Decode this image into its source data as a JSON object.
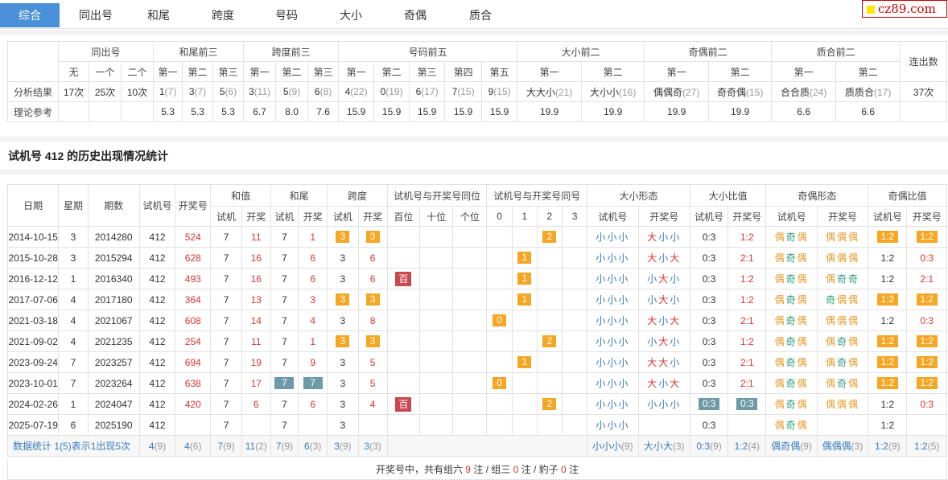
{
  "tabs": [
    "综合",
    "同出号",
    "和尾",
    "跨度",
    "号码",
    "大小",
    "奇偶",
    "质合"
  ],
  "logo": "cz89.com",
  "summary": {
    "groups": [
      "同出号",
      "和尾前三",
      "跨度前三",
      "号码前五",
      "大小前二",
      "奇偶前二",
      "质合前二",
      "连出数"
    ],
    "sub": [
      "无",
      "一个",
      "二个",
      "第一",
      "第二",
      "第三",
      "第一",
      "第二",
      "第三",
      "第一",
      "第二",
      "第三",
      "第四",
      "第五",
      "第一",
      "第二",
      "第一",
      "第二",
      "第一",
      "第二"
    ],
    "row1_label": "分析结果",
    "row1": [
      [
        "17次",
        ""
      ],
      [
        "25次",
        ""
      ],
      [
        "10次",
        ""
      ],
      [
        "1",
        "(7)"
      ],
      [
        "3",
        "(7)"
      ],
      [
        "5",
        "(6)"
      ],
      [
        "3",
        "(11)"
      ],
      [
        "5",
        "(9)"
      ],
      [
        "6",
        "(8)"
      ],
      [
        "4",
        "(22)"
      ],
      [
        "0",
        "(19)"
      ],
      [
        "6",
        "(17)"
      ],
      [
        "7",
        "(15)"
      ],
      [
        "9",
        "(15)"
      ],
      [
        "大大小",
        "(21)"
      ],
      [
        "大小小",
        "(16)"
      ],
      [
        "偶偶奇",
        "(27)"
      ],
      [
        "奇奇偶",
        "(15)"
      ],
      [
        "合合质",
        "(24)"
      ],
      [
        "质质合",
        "(17)"
      ],
      [
        "37次",
        ""
      ]
    ],
    "row2_label": "理论参考",
    "row2": [
      "",
      "",
      "",
      "5.3",
      "5.3",
      "5.3",
      "6.7",
      "8.0",
      "7.6",
      "15.9",
      "15.9",
      "15.9",
      "15.9",
      "15.9",
      "19.9",
      "19.9",
      "19.9",
      "19.9",
      "6.6",
      "6.6",
      ""
    ]
  },
  "section_title": "试机号 412 的历史出现情况统计",
  "hist": {
    "h1": [
      "日期",
      "星期",
      "期数",
      "试机号",
      "开奖号",
      "和值",
      "和尾",
      "跨度",
      "试机号与开奖号同位",
      "试机号与开奖号同号",
      "大小形态",
      "大小比值",
      "奇偶形态",
      "奇偶比值"
    ],
    "h2": [
      "试机",
      "开奖",
      "试机",
      "开奖",
      "试机",
      "开奖",
      "百位",
      "十位",
      "个位",
      "0",
      "1",
      "2",
      "3",
      "试机号",
      "开奖号",
      "试机号",
      "开奖号",
      "试机号",
      "开奖号",
      "试机号",
      "开奖号"
    ],
    "rows": [
      {
        "date": "2014-10-15",
        "wk": "3",
        "issue": "2014280",
        "sj": "412",
        "kj": "524",
        "hz_s": "7",
        "hz_k": "11",
        "hw_s": "7",
        "hw_k": "1",
        "kd_s": "3",
        "kd_k": "3",
        "kd_hl": "o",
        "pos": "",
        "pos_i": -1,
        "same": "2",
        "same_i": 2,
        "dx_s": "小小小",
        "dx_k": [
          "大",
          "小",
          "小"
        ],
        "dxb_s": "0:3",
        "dxb_k": "1:2",
        "dxb_hl": "",
        "jo_s": "偶奇偶",
        "jo_k": [
          "偶",
          "偶",
          "偶"
        ],
        "job_s": "1:2",
        "job_k": "1:2",
        "job_hl": "o",
        "hw_hl": ""
      },
      {
        "date": "2015-10-28",
        "wk": "3",
        "issue": "2015294",
        "sj": "412",
        "kj": "628",
        "hz_s": "7",
        "hz_k": "16",
        "hw_s": "7",
        "hw_k": "6",
        "kd_s": "3",
        "kd_k": "6",
        "kd_hl": "",
        "pos": "",
        "pos_i": -1,
        "same": "1",
        "same_i": 1,
        "dx_s": "小小小",
        "dx_k": [
          "大",
          "小",
          "大"
        ],
        "dxb_s": "0:3",
        "dxb_k": "2:1",
        "dxb_hl": "",
        "jo_s": "偶奇偶",
        "jo_k": [
          "偶",
          "偶",
          "偶"
        ],
        "job_s": "1:2",
        "job_k": "0:3",
        "job_hl": "",
        "hw_hl": ""
      },
      {
        "date": "2016-12-12",
        "wk": "1",
        "issue": "2016340",
        "sj": "412",
        "kj": "493",
        "hz_s": "7",
        "hz_k": "16",
        "hw_s": "7",
        "hw_k": "6",
        "kd_s": "3",
        "kd_k": "6",
        "kd_hl": "",
        "pos": "百",
        "pos_i": 0,
        "same": "1",
        "same_i": 1,
        "dx_s": "小小小",
        "dx_k": [
          "小",
          "大",
          "小"
        ],
        "dxb_s": "0:3",
        "dxb_k": "1:2",
        "dxb_hl": "",
        "jo_s": "偶奇偶",
        "jo_k": [
          "偶",
          "奇",
          "奇"
        ],
        "job_s": "1:2",
        "job_k": "2:1",
        "job_hl": "",
        "hw_hl": ""
      },
      {
        "date": "2017-07-06",
        "wk": "4",
        "issue": "2017180",
        "sj": "412",
        "kj": "364",
        "hz_s": "7",
        "hz_k": "13",
        "hw_s": "7",
        "hw_k": "3",
        "kd_s": "3",
        "kd_k": "3",
        "kd_hl": "o",
        "pos": "",
        "pos_i": -1,
        "same": "1",
        "same_i": 1,
        "dx_s": "小小小",
        "dx_k": [
          "小",
          "大",
          "小"
        ],
        "dxb_s": "0:3",
        "dxb_k": "1:2",
        "dxb_hl": "",
        "jo_s": "偶奇偶",
        "jo_k": [
          "奇",
          "偶",
          "偶"
        ],
        "job_s": "1:2",
        "job_k": "1:2",
        "job_hl": "o",
        "hw_hl": ""
      },
      {
        "date": "2021-03-18",
        "wk": "4",
        "issue": "2021067",
        "sj": "412",
        "kj": "608",
        "hz_s": "7",
        "hz_k": "14",
        "hw_s": "7",
        "hw_k": "4",
        "kd_s": "3",
        "kd_k": "8",
        "kd_hl": "",
        "pos": "",
        "pos_i": -1,
        "same": "0",
        "same_i": 0,
        "dx_s": "小小小",
        "dx_k": [
          "大",
          "小",
          "大"
        ],
        "dxb_s": "0:3",
        "dxb_k": "2:1",
        "dxb_hl": "",
        "jo_s": "偶奇偶",
        "jo_k": [
          "偶",
          "偶",
          "偶"
        ],
        "job_s": "1:2",
        "job_k": "0:3",
        "job_hl": "",
        "hw_hl": ""
      },
      {
        "date": "2021-09-02",
        "wk": "4",
        "issue": "2021235",
        "sj": "412",
        "kj": "254",
        "hz_s": "7",
        "hz_k": "11",
        "hw_s": "7",
        "hw_k": "1",
        "kd_s": "3",
        "kd_k": "3",
        "kd_hl": "o",
        "pos": "",
        "pos_i": -1,
        "same": "2",
        "same_i": 2,
        "dx_s": "小小小",
        "dx_k": [
          "小",
          "大",
          "小"
        ],
        "dxb_s": "0:3",
        "dxb_k": "1:2",
        "dxb_hl": "",
        "jo_s": "偶奇偶",
        "jo_k": [
          "偶",
          "奇",
          "偶"
        ],
        "job_s": "1:2",
        "job_k": "1:2",
        "job_hl": "o",
        "hw_hl": ""
      },
      {
        "date": "2023-09-24",
        "wk": "7",
        "issue": "2023257",
        "sj": "412",
        "kj": "694",
        "hz_s": "7",
        "hz_k": "19",
        "hw_s": "7",
        "hw_k": "9",
        "kd_s": "3",
        "kd_k": "5",
        "kd_hl": "",
        "pos": "",
        "pos_i": -1,
        "same": "1",
        "same_i": 1,
        "dx_s": "小小小",
        "dx_k": [
          "大",
          "大",
          "小"
        ],
        "dxb_s": "0:3",
        "dxb_k": "2:1",
        "dxb_hl": "",
        "jo_s": "偶奇偶",
        "jo_k": [
          "偶",
          "奇",
          "偶"
        ],
        "job_s": "1:2",
        "job_k": "1:2",
        "job_hl": "o",
        "hw_hl": ""
      },
      {
        "date": "2023-10-01",
        "wk": "7",
        "issue": "2023264",
        "sj": "412",
        "kj": "638",
        "hz_s": "7",
        "hz_k": "17",
        "hw_s": "7",
        "hw_k": "7",
        "kd_s": "3",
        "kd_k": "5",
        "kd_hl": "",
        "pos": "",
        "pos_i": -1,
        "same": "0",
        "same_i": 0,
        "dx_s": "小小小",
        "dx_k": [
          "大",
          "小",
          "大"
        ],
        "dxb_s": "0:3",
        "dxb_k": "2:1",
        "dxb_hl": "",
        "jo_s": "偶奇偶",
        "jo_k": [
          "偶",
          "奇",
          "偶"
        ],
        "job_s": "1:2",
        "job_k": "1:2",
        "job_hl": "o",
        "hw_hl": "g"
      },
      {
        "date": "2024-02-26",
        "wk": "1",
        "issue": "2024047",
        "sj": "412",
        "kj": "420",
        "hz_s": "7",
        "hz_k": "6",
        "hw_s": "7",
        "hw_k": "6",
        "kd_s": "3",
        "kd_k": "4",
        "kd_hl": "",
        "pos": "百",
        "pos_i": 0,
        "same": "2",
        "same_i": 2,
        "dx_s": "小小小",
        "dx_k": [
          "小",
          "小",
          "小"
        ],
        "dxb_s": "0:3",
        "dxb_k": "0:3",
        "dxb_hl": "g",
        "jo_s": "偶奇偶",
        "jo_k": [
          "偶",
          "偶",
          "偶"
        ],
        "job_s": "1:2",
        "job_k": "0:3",
        "job_hl": "",
        "hw_hl": ""
      },
      {
        "date": "2025-07-19",
        "wk": "6",
        "issue": "2025190",
        "sj": "412",
        "kj": "",
        "hz_s": "7",
        "hz_k": "",
        "hw_s": "7",
        "hw_k": "",
        "kd_s": "3",
        "kd_k": "",
        "kd_hl": "",
        "pos": "",
        "pos_i": -1,
        "same": "",
        "same_i": -1,
        "dx_s": "小小小",
        "dx_k": [
          "",
          "",
          ""
        ],
        "dxb_s": "0:3",
        "dxb_k": "",
        "dxb_hl": "",
        "jo_s": "偶奇偶",
        "jo_k": [
          "",
          "",
          ""
        ],
        "job_s": "1:2",
        "job_k": "",
        "job_hl": "",
        "hw_hl": ""
      }
    ],
    "stat": {
      "label": "数据统计",
      "note": "1(5)表示1出现5次",
      "cells": [
        [
          "4",
          "(9)"
        ],
        [
          "4",
          "(6)"
        ],
        [
          "7",
          "(9)"
        ],
        [
          "11",
          "(2)"
        ],
        [
          "7",
          "(9)"
        ],
        [
          "6",
          "(3)"
        ],
        [
          "3",
          "(9)"
        ],
        [
          "3",
          "(3)"
        ],
        [
          "",
          "",
          ""
        ],
        [
          "小小小",
          "(9)"
        ],
        [
          "大小大",
          "(3)"
        ],
        [
          "0:3",
          "(9)"
        ],
        [
          "1:2",
          "(4)"
        ],
        [
          "偶奇偶",
          "(9)"
        ],
        [
          "偶偶偶",
          "(3)"
        ],
        [
          "1:2",
          "(9)"
        ],
        [
          "1:2",
          "(5)"
        ]
      ]
    },
    "footer": {
      "p1": "开奖号中，共有组六",
      "n1": "9",
      "p2": "注 / 组三",
      "n2": "0",
      "p3": "注 / 豹子",
      "n3": "0",
      "p4": "注"
    }
  },
  "colors": {
    "accent": "#4a90d9",
    "orange": "#f5a623",
    "teal": "#6d9aa6",
    "red_badge": "#c9474e",
    "red_text": "#dd3333",
    "blue_text": "#3a7bc0"
  }
}
